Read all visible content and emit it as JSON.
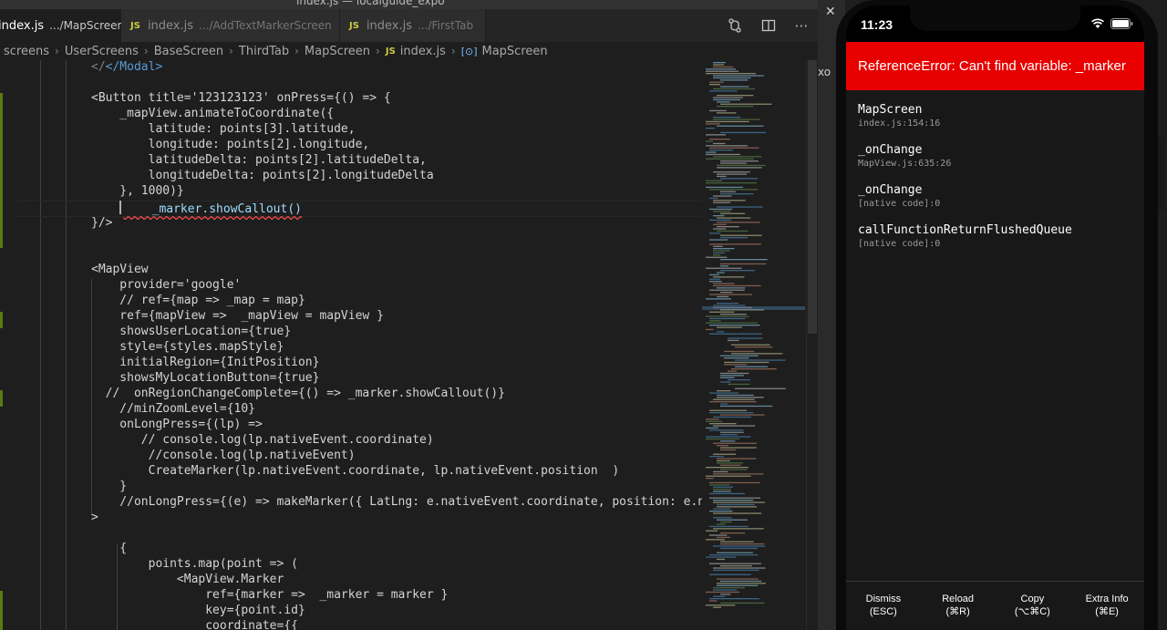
{
  "window": {
    "title": "index.js — localguide_expo"
  },
  "tabs": [
    {
      "name": "index.js",
      "path": ".../MapScreen",
      "active": true,
      "modified": true
    },
    {
      "name": "index.js",
      "path": ".../AddTextMarkerScreen",
      "active": false
    },
    {
      "name": "index.js",
      "path": ".../FirstTab",
      "active": false
    }
  ],
  "breadcrumb": [
    "screens",
    "UserScreens",
    "BaseScreen",
    "ThirdTab",
    "MapScreen",
    "index.js",
    "MapScreen"
  ],
  "code": [
    "</Modal>",
    "",
    "<Button title='123123123' onPress={() => {",
    "    _mapView.animateToCoordinate({",
    "        latitude: points[3].latitude,",
    "        longitude: points[2].longitude,",
    "        latitudeDelta: points[2].latitudeDelta,",
    "        longitudeDelta: points[2].longitudeDelta",
    "    }, 1000)}",
    "    _marker.showCallout()",
    "}/>",
    "",
    "",
    "<MapView",
    "    provider='google'",
    "    // ref={map => _map = map}",
    "    ref={mapView =>  _mapView = mapView }",
    "    showsUserLocation={true}",
    "    style={styles.mapStyle}",
    "    initialRegion={InitPosition}",
    "    showsMyLocationButton={true}",
    "  //  onRegionChangeComplete={() => _marker.showCallout()}",
    "    //minZoomLevel={10}",
    "    onLongPress={(lp) =>",
    "       // console.log(lp.nativeEvent.coordinate)",
    "        //console.log(lp.nativeEvent)",
    "        CreateMarker(lp.nativeEvent.coordinate, lp.nativeEvent.position  )",
    "    }",
    "    //onLongPress={(e) => makeMarker({ LatLng: e.nativeEvent.coordinate, position: e.nativeEvent.P",
    ">",
    "",
    "",
    "    {",
    "        points.map(point => (",
    "            <MapView.Marker",
    "                ref={marker =>  _marker = marker }",
    "                key={point.id}",
    "                coordinate={{"
  ],
  "simulator": {
    "time": "11:23",
    "error_title": "ReferenceError: Can't find variable: _marker",
    "frames": [
      {
        "fn": "MapScreen",
        "loc": "index.js:154:16"
      },
      {
        "fn": "_onChange",
        "loc": "MapView.js:635:26"
      },
      {
        "fn": "_onChange",
        "loc": "[native code]:0"
      },
      {
        "fn": "callFunctionReturnFlushedQueue",
        "loc": "[native code]:0"
      }
    ],
    "actions": [
      {
        "label": "Dismiss",
        "shortcut": "(ESC)"
      },
      {
        "label": "Reload",
        "shortcut": "(⌘R)"
      },
      {
        "label": "Copy",
        "shortcut": "(⌥⌘C)"
      },
      {
        "label": "Extra Info",
        "shortcut": "(⌘E)"
      }
    ]
  },
  "strip": {
    "fragment": "xo"
  },
  "colors": {
    "error_red": "#e80000",
    "editor_bg": "#1e1e1e",
    "tab_bg": "#252526"
  },
  "icons": [
    "close-icon",
    "source-control-icon",
    "split-editor-icon",
    "more-icon",
    "js-file-icon",
    "symbol-icon",
    "chevron-right-icon",
    "wifi-icon",
    "battery-icon"
  ]
}
